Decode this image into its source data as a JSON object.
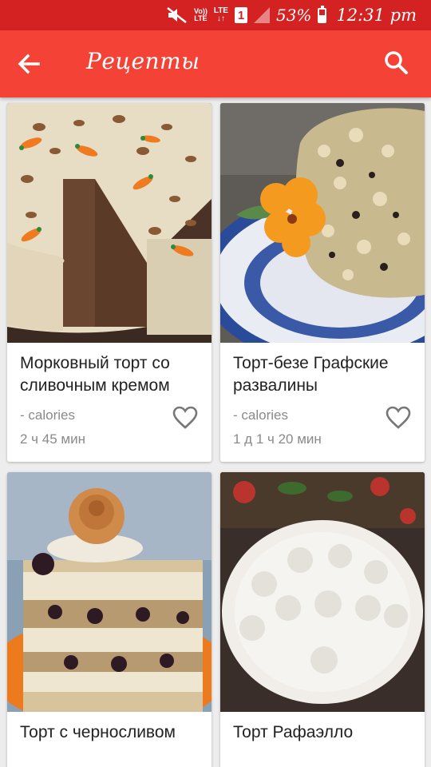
{
  "status_bar": {
    "volte_line1": "Vo))",
    "volte_line2": "LTE",
    "lte": "LTE",
    "lte_arrows": "↓↑",
    "sim": "1",
    "battery": "53%",
    "time": "12:31 pm",
    "icons": [
      "mute-icon",
      "signal-icon",
      "battery-icon"
    ]
  },
  "app_bar": {
    "title": "Рецепты",
    "back_icon": "arrow-left-icon",
    "search_icon": "search-icon",
    "color": "#f44236",
    "status_color": "#d42222"
  },
  "recipes": [
    {
      "title": "Морковный торт со сливочным кремом",
      "calories": "- calories",
      "time": "2 ч 45 мин",
      "favorite_icon": "heart-outline-icon"
    },
    {
      "title": "Торт-безе Графские развалины",
      "calories": "- calories",
      "time": "1 д 1 ч 20 мин",
      "favorite_icon": "heart-outline-icon"
    },
    {
      "title": "Торт с черносливом"
    },
    {
      "title": "Торт Рафаэлло"
    }
  ]
}
